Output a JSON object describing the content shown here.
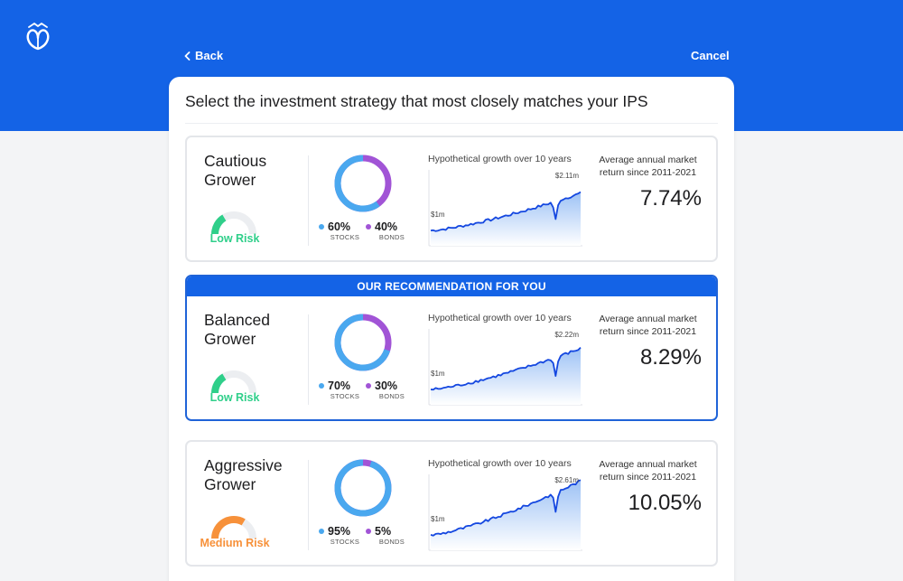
{
  "header": {
    "logo_icon": "leaf-logo-icon",
    "back_label": "Back",
    "cancel_label": "Cancel"
  },
  "panel": {
    "title": "Select the investment strategy that most closely matches your IPS"
  },
  "colors": {
    "brand_blue": "#1463e6",
    "stocks": "#4aa8ef",
    "bonds": "#a154d6",
    "low_risk": "#2fcf8a",
    "medium_risk": "#f7913a",
    "chart_line": "#1447e0"
  },
  "strategies": [
    {
      "name": "Cautious Grower",
      "risk_label": "Low Risk",
      "risk_level": 0.33,
      "risk_color": "#2fcf8a",
      "recommended": false,
      "stocks_pct": "60%",
      "stocks_label": "STOCKS",
      "bonds_pct": "40%",
      "bonds_label": "BONDS",
      "stocks_fraction": 0.6,
      "chart_title": "Hypothetical growth over 10 years",
      "chart_start": "$1m",
      "chart_end": "$2.11m",
      "return_label": "Average annual market return since 2011-2021",
      "return_value": "7.74%"
    },
    {
      "name": "Balanced Grower",
      "risk_label": "Low Risk",
      "risk_level": 0.33,
      "risk_color": "#2fcf8a",
      "recommended": true,
      "recommended_label": "OUR RECOMMENDATION FOR YOU",
      "stocks_pct": "70%",
      "stocks_label": "STOCKS",
      "bonds_pct": "30%",
      "bonds_label": "BONDS",
      "stocks_fraction": 0.7,
      "chart_title": "Hypothetical growth over 10 years",
      "chart_start": "$1m",
      "chart_end": "$2.22m",
      "return_label": "Average annual market return since 2011-2021",
      "return_value": "8.29%"
    },
    {
      "name": "Aggressive Grower",
      "risk_label": "Medium Risk",
      "risk_level": 0.67,
      "risk_color": "#f7913a",
      "recommended": false,
      "stocks_pct": "95%",
      "stocks_label": "STOCKS",
      "bonds_pct": "5%",
      "bonds_label": "BONDS",
      "stocks_fraction": 0.95,
      "chart_title": "Hypothetical growth over 10 years",
      "chart_start": "$1m",
      "chart_end": "$2.61m",
      "return_label": "Average annual market return since 2011-2021",
      "return_value": "10.05%"
    }
  ]
}
